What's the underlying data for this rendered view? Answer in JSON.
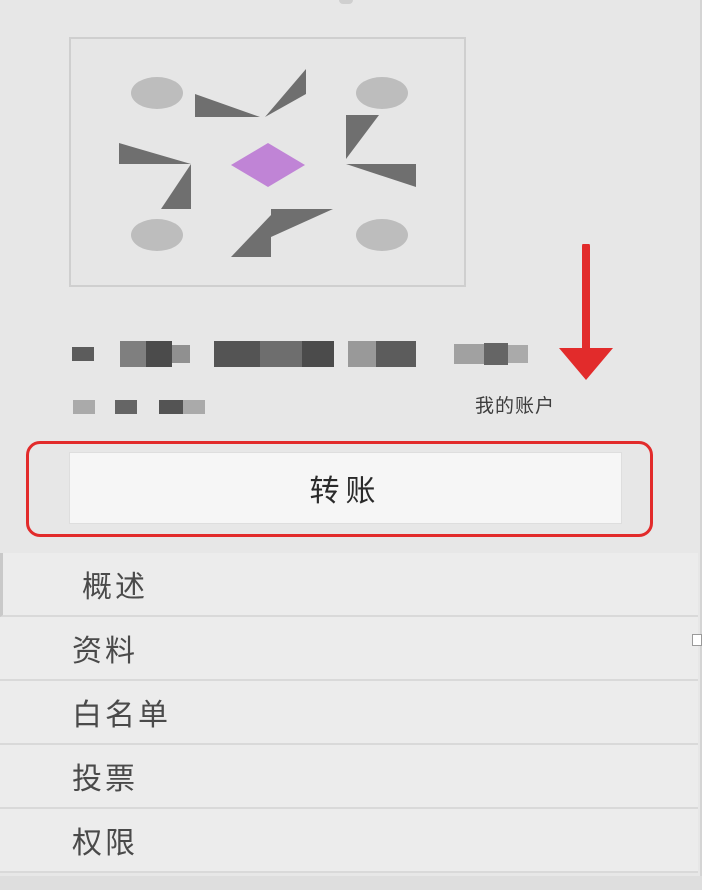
{
  "account": {
    "label": "我的账户",
    "transfer_label": "转账"
  },
  "colors": {
    "accent_outline": "#e22b2b",
    "identicon_center": "#c084d6",
    "identicon_shapes": "#6f6f6f",
    "identicon_dots": "#bdbdbd"
  },
  "icons": {
    "account_identicon": "identicon-image",
    "arrow": "red-down-arrow-icon"
  },
  "menu": {
    "items": [
      {
        "label": "概述"
      },
      {
        "label": "资料"
      },
      {
        "label": "白名单"
      },
      {
        "label": "投票"
      },
      {
        "label": "权限"
      }
    ]
  }
}
